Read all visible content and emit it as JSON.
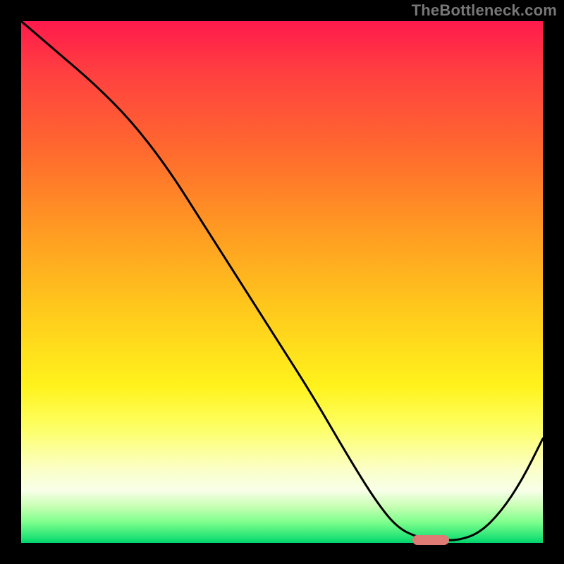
{
  "watermark": {
    "text": "TheBottleneck.com"
  },
  "colors": {
    "marker": "#e07a74",
    "curve": "#000000",
    "frame": "#000000"
  },
  "chart_data": {
    "type": "line",
    "title": "",
    "xlabel": "",
    "ylabel": "",
    "xlim": [
      0,
      100
    ],
    "ylim": [
      0,
      100
    ],
    "grid": false,
    "legend": false,
    "note": "Axes unlabeled. Values are estimated from the image where 0 = bottom/left edge of the gradient panel and 100 = top/right edge.",
    "series": [
      {
        "name": "bottleneck-curve",
        "x": [
          0,
          7,
          14,
          21,
          28,
          35,
          42,
          49,
          56,
          63,
          68,
          72,
          76,
          80,
          84,
          88,
          92,
          96,
          100
        ],
        "values": [
          100,
          94,
          88,
          81,
          72,
          61,
          50,
          39,
          28,
          16,
          8,
          3,
          1,
          0.5,
          0.5,
          2,
          6,
          12,
          20
        ]
      }
    ],
    "marker": {
      "note": "Pink rounded bar marking the curve minimum",
      "x_start": 75,
      "x_end": 82,
      "y": 0.5
    },
    "background": {
      "type": "vertical-gradient",
      "stops": [
        {
          "pos": 0,
          "color": "#ff1a4c"
        },
        {
          "pos": 25,
          "color": "#ff6a2e"
        },
        {
          "pos": 55,
          "color": "#ffc81c"
        },
        {
          "pos": 78,
          "color": "#fdff66"
        },
        {
          "pos": 93,
          "color": "#c8ffb4"
        },
        {
          "pos": 100,
          "color": "#00d36b"
        }
      ]
    }
  }
}
